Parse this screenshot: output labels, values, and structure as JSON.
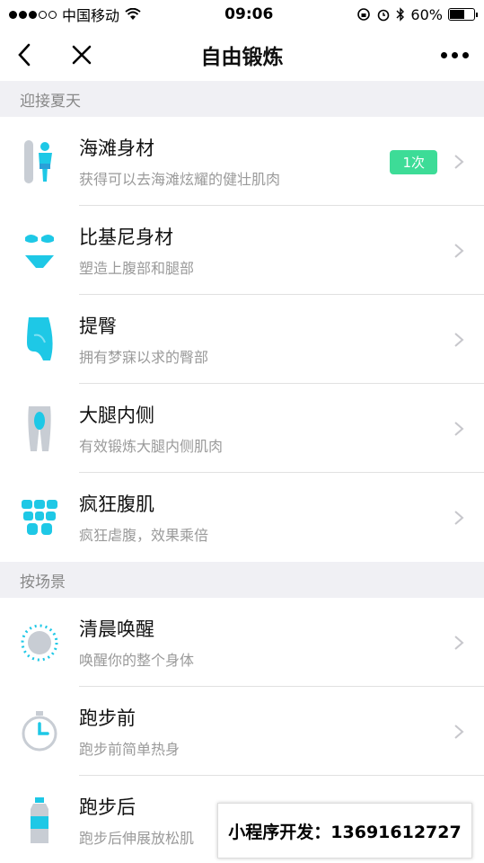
{
  "status_bar": {
    "carrier": "中国移动",
    "time": "09:06",
    "battery_text": "60%",
    "battery_level": 0.6
  },
  "nav": {
    "title": "自由锻炼"
  },
  "sections": [
    {
      "header": "迎接夏天",
      "items": [
        {
          "title": "海滩身材",
          "subtitle": "获得可以去海滩炫耀的健壮肌肉",
          "badge": "1次",
          "icon": "surfer-icon"
        },
        {
          "title": "比基尼身材",
          "subtitle": "塑造上腹部和腿部",
          "icon": "bikini-icon"
        },
        {
          "title": "提臀",
          "subtitle": "拥有梦寐以求的臀部",
          "icon": "buttocks-icon"
        },
        {
          "title": "大腿内侧",
          "subtitle": "有效锻炼大腿内侧肌肉",
          "icon": "inner-thigh-icon"
        },
        {
          "title": "疯狂腹肌",
          "subtitle": "疯狂虐腹，效果乘倍",
          "icon": "abs-icon"
        }
      ]
    },
    {
      "header": "按场景",
      "items": [
        {
          "title": "清晨唤醒",
          "subtitle": "唤醒你的整个身体",
          "icon": "sunrise-icon"
        },
        {
          "title": "跑步前",
          "subtitle": "跑步前简单热身",
          "icon": "stopwatch-icon"
        },
        {
          "title": "跑步后",
          "subtitle": "跑步后伸展放松肌",
          "icon": "water-bottle-icon"
        }
      ]
    }
  ],
  "promo": {
    "text": "小程序开发：13691612727"
  },
  "colors": {
    "accent_cyan": "#1ec8e6",
    "badge_green": "#3ddc97",
    "section_bg": "#f0f0f4"
  }
}
